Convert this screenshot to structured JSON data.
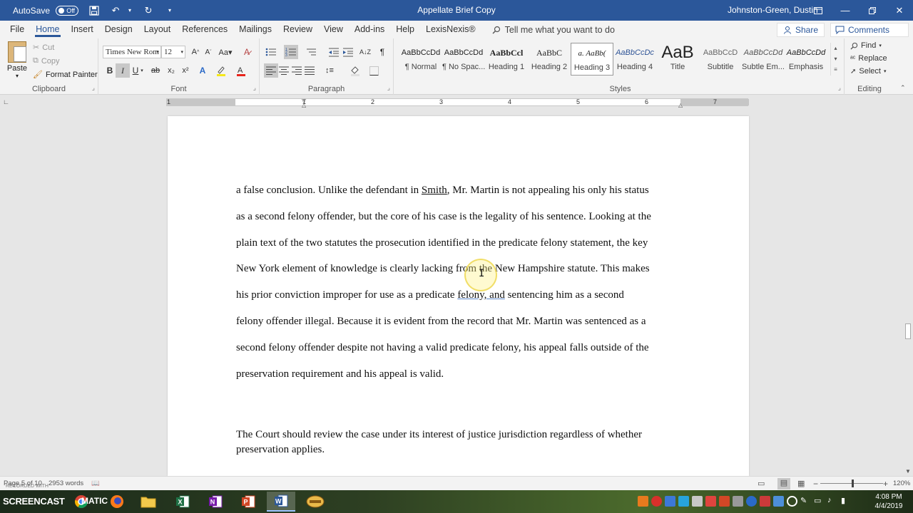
{
  "titlebar": {
    "autosave_label": "AutoSave",
    "autosave_state": "Off",
    "document_title": "Appellate Brief Copy",
    "user_name": "Johnston-Green, Dustin"
  },
  "tabs": [
    "File",
    "Home",
    "Insert",
    "Design",
    "Layout",
    "References",
    "Mailings",
    "Review",
    "View",
    "Add-ins",
    "Help",
    "LexisNexis®"
  ],
  "tellme": "Tell me what you want to do",
  "share_label": "Share",
  "comments_label": "Comments",
  "clipboard": {
    "paste": "Paste",
    "cut": "Cut",
    "copy": "Copy",
    "format_painter": "Format Painter",
    "group_label": "Clipboard"
  },
  "font": {
    "name": "Times New Rom",
    "size": "12",
    "group_label": "Font"
  },
  "paragraph": {
    "group_label": "Paragraph"
  },
  "styles": {
    "group_label": "Styles",
    "items": [
      {
        "sample": "AaBbCcDd",
        "name": "¶ Normal"
      },
      {
        "sample": "AaBbCcDd",
        "name": "¶ No Spac..."
      },
      {
        "sample": "AaBbCcl",
        "name": "Heading 1"
      },
      {
        "sample": "AaBbC",
        "name": "Heading 2"
      },
      {
        "sample": "a. AaBb(",
        "name": "Heading 3"
      },
      {
        "sample": "AaBbCcDc",
        "name": "Heading 4"
      },
      {
        "sample": "AaB",
        "name": "Title"
      },
      {
        "sample": "AaBbCcD",
        "name": "Subtitle"
      },
      {
        "sample": "AaBbCcDd",
        "name": "Subtle Em..."
      },
      {
        "sample": "AaBbCcDd",
        "name": "Emphasis"
      }
    ]
  },
  "editing": {
    "find": "Find",
    "replace": "Replace",
    "select": "Select",
    "group_label": "Editing"
  },
  "ruler_numbers": [
    "1",
    "1",
    "2",
    "3",
    "4",
    "5",
    "6",
    "7"
  ],
  "document": {
    "para1": [
      {
        "pre": "a false conclusion. Unlike the defendant in ",
        "u": "Smith",
        "post": ", Mr. Martin is not appealing his only his status"
      },
      {
        "text": "as a second felony offender, but the core of his case is the legality of his sentence. Looking at the"
      },
      {
        "text": "plain text of the two statutes the prosecution identified in the predicate felony statement, the key"
      },
      {
        "text": "New York element of knowledge is clearly lacking from the New Hampshire statute. This makes"
      },
      {
        "pre": "his prior conviction improper for use as a predicate ",
        "u": "felony, and",
        "post": " sentencing him as a second"
      },
      {
        "text": "felony offender illegal. Because it is evident from the record that Mr. Martin was sentenced as a"
      },
      {
        "text": "second felony offender despite not having a valid predicate felony, his appeal falls outside of the"
      },
      {
        "text": "preservation requirement and his appeal is valid."
      }
    ],
    "para2": [
      "The Court should review the case under its interest of justice jurisdiction regardless of whether",
      "preservation applies."
    ]
  },
  "status": {
    "page": "Page 5 of 10",
    "words": "2953 words",
    "zoom": "120%",
    "watermark": "RECORDED WITH"
  },
  "taskbar": {
    "logo": "SCREENCAST",
    "logo2": "MATIC",
    "time": "4:08 PM",
    "date": "4/4/2019"
  }
}
